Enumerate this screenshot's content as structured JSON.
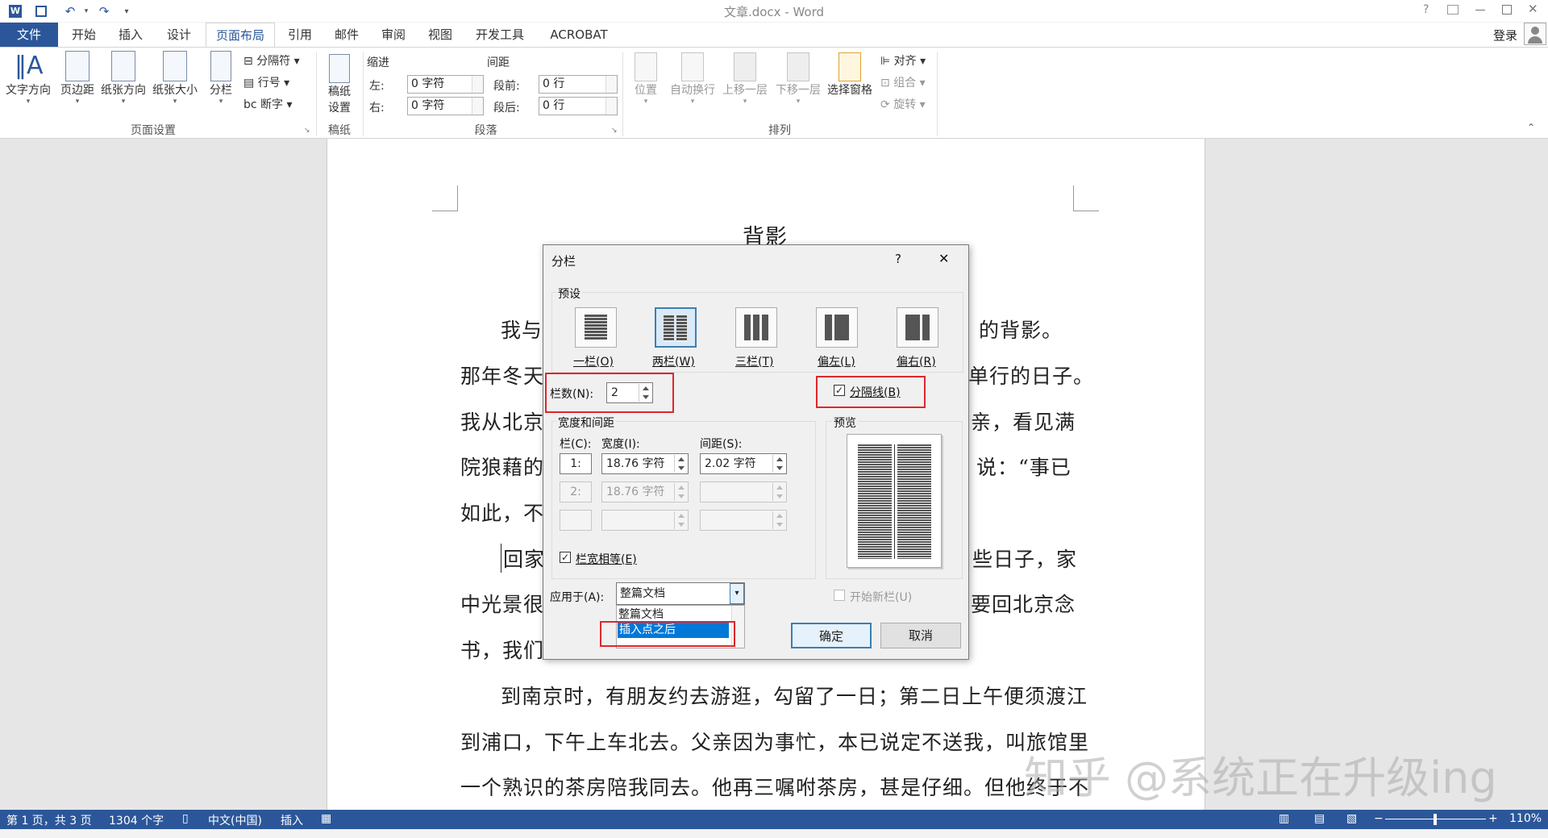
{
  "titlebar": {
    "title": "文章.docx - Word",
    "login": "登录",
    "help": "?"
  },
  "tabs": [
    {
      "label": "文件"
    },
    {
      "label": "开始"
    },
    {
      "label": "插入"
    },
    {
      "label": "设计"
    },
    {
      "label": "页面布局"
    },
    {
      "label": "引用"
    },
    {
      "label": "邮件"
    },
    {
      "label": "审阅"
    },
    {
      "label": "视图"
    },
    {
      "label": "开发工具"
    },
    {
      "label": "ACROBAT"
    }
  ],
  "ribbon": {
    "page_setup": {
      "text_dir": "文字方向",
      "margins": "页边距",
      "orientation": "纸张方向",
      "size": "纸张大小",
      "columns": "分栏",
      "breaks": "分隔符",
      "line_numbers": "行号",
      "hyphenation": "断字",
      "group": "页面设置"
    },
    "manuscript": {
      "label1": "稿纸",
      "label2": "设置",
      "group": "稿纸"
    },
    "paragraph": {
      "indent_title": "缩进",
      "spacing_title": "间距",
      "left_label": "左:",
      "left_val": "0 字符",
      "right_label": "右:",
      "right_val": "0 字符",
      "before_label": "段前:",
      "before_val": "0 行",
      "after_label": "段后:",
      "after_val": "0 行",
      "group": "段落"
    },
    "arrange": {
      "position": "位置",
      "wrap": "自动换行",
      "forward": "上移一层",
      "backward": "下移一层",
      "selection": "选择窗格",
      "align": "对齐",
      "group_btn": "组合",
      "rotate": "旋转",
      "group": "排列"
    }
  },
  "document": {
    "title": "背影",
    "lines": [
      "我与",
      "的背影。",
      "那年冬天",
      "单行的日子。",
      "我从北京",
      "亲，看见满",
      "院狼藉的",
      "说：“事已",
      "如此，不",
      "回家",
      "些日子，家",
      "中光景很",
      "要回北京念",
      "书，我们",
      "到南京时，有朋友约去游逛，勾留了一日；第二日上午便须渡江",
      "到浦口，下午上车北去。父亲因为事忙，本已说定不送我，叫旅馆里",
      "一个熟识的茶房陪我同去。他再三嘱咐茶房，甚是仔细。但他终于不"
    ]
  },
  "dialog": {
    "title": "分栏",
    "help": "?",
    "close": "✕",
    "preset_label": "预设",
    "presets": [
      {
        "label": "一栏(O)"
      },
      {
        "label": "两栏(W)"
      },
      {
        "label": "三栏(T)"
      },
      {
        "label": "偏左(L)"
      },
      {
        "label": "偏右(R)"
      }
    ],
    "num_cols_label": "栏数(N):",
    "num_cols_value": "2",
    "line_between_label": "分隔线(B)",
    "line_between_checked": true,
    "width_spacing_label": "宽度和间距",
    "col_hdr": "栏(C):",
    "width_hdr": "宽度(I):",
    "spacing_hdr": "间距(S):",
    "rows": [
      {
        "col": "1:",
        "width": "18.76 字符",
        "spacing": "2.02 字符"
      },
      {
        "col": "2:",
        "width": "18.76 字符",
        "spacing": ""
      },
      {
        "col": "",
        "width": "",
        "spacing": ""
      }
    ],
    "equal_width_label": "栏宽相等(E)",
    "equal_width_checked": true,
    "preview_label": "预览",
    "apply_label": "应用于(A):",
    "apply_value": "整篇文档",
    "apply_options": [
      "整篇文档",
      "插入点之后"
    ],
    "new_col_label": "开始新栏(U)",
    "ok": "确定",
    "cancel": "取消"
  },
  "status": {
    "page": "第 1 页，共 3 页",
    "words": "1304 个字",
    "lang": "中文(中国)",
    "mode": "插入",
    "zoom": "110%"
  },
  "watermark": "知乎 @系统正在升级ing",
  "colors": {
    "accent": "#2b579a",
    "highlight": "#e0262c",
    "selection": "#0078d7"
  }
}
